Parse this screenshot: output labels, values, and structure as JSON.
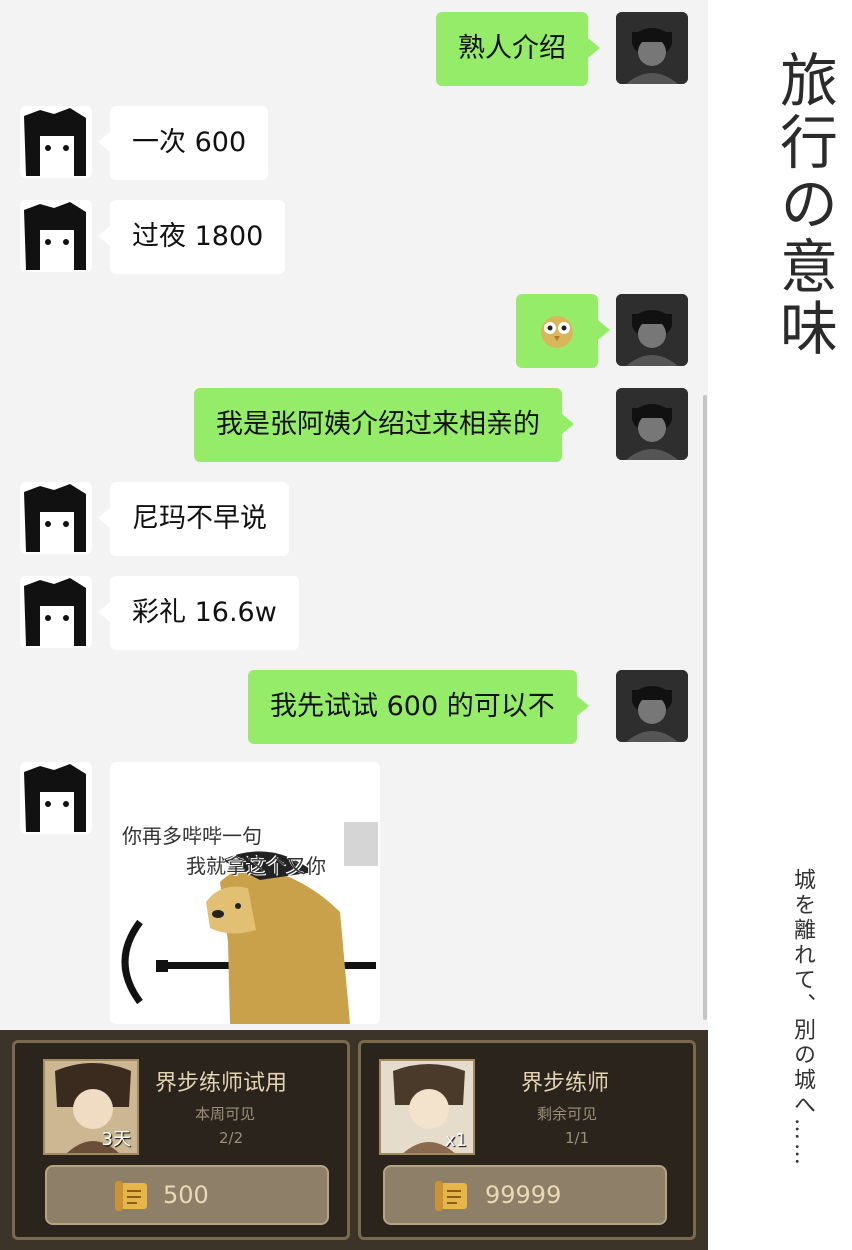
{
  "messages": [
    {
      "side": "self",
      "text": "熟人介绍"
    },
    {
      "side": "other",
      "text": "一次 600"
    },
    {
      "side": "other",
      "text": "过夜 1800"
    },
    {
      "side": "self",
      "text": "owl-emoji"
    },
    {
      "side": "self",
      "text": "我是张阿姨介绍过来相亲的"
    },
    {
      "side": "other",
      "text": "尼玛不早说"
    },
    {
      "side": "other",
      "text": "彩礼 16.6w"
    },
    {
      "side": "self",
      "text": "我先试试 600 的可以不"
    }
  ],
  "sticker": {
    "caption_line1": "你再多哔哔一句",
    "caption_line2": "我就拿这个叉你"
  },
  "gamebar": {
    "left": {
      "title": "界步练师试用",
      "label": "本周可见",
      "count": "2/2",
      "badge": "3天",
      "price": "500"
    },
    "right": {
      "title": "界步练师",
      "label": "剩余可见",
      "count": "1/1",
      "badge": "x1",
      "price": "99999"
    }
  },
  "sidebar": {
    "title": "旅行の意味",
    "subtitle": "城を離れて、別の城へ……"
  },
  "colors": {
    "self_bubble": "#95ec69",
    "other_bubble": "#ffffff",
    "chat_bg": "#f3f3f3",
    "gamebar_bg": "#3d3429"
  }
}
